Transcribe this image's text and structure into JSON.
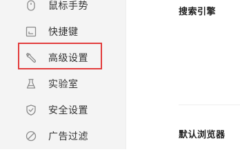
{
  "sidebar": {
    "items": [
      {
        "label": "鼠标手势",
        "icon": "mouse-icon"
      },
      {
        "label": "快捷键",
        "icon": "keyboard-icon"
      },
      {
        "label": "高级设置",
        "icon": "wrench-icon",
        "highlighted": true
      },
      {
        "label": "实验室",
        "icon": "flask-icon"
      },
      {
        "label": "安全设置",
        "icon": "shield-check-icon"
      },
      {
        "label": "广告过滤",
        "icon": "block-icon"
      }
    ]
  },
  "main": {
    "sections": [
      {
        "title": "搜索引擎"
      },
      {
        "title": "默认浏览器"
      }
    ]
  },
  "colors": {
    "sidebar_bg": "#f4f4f4",
    "highlight_border": "#e23a3a",
    "icon_stroke": "#8a8a8a",
    "text": "#333333"
  }
}
